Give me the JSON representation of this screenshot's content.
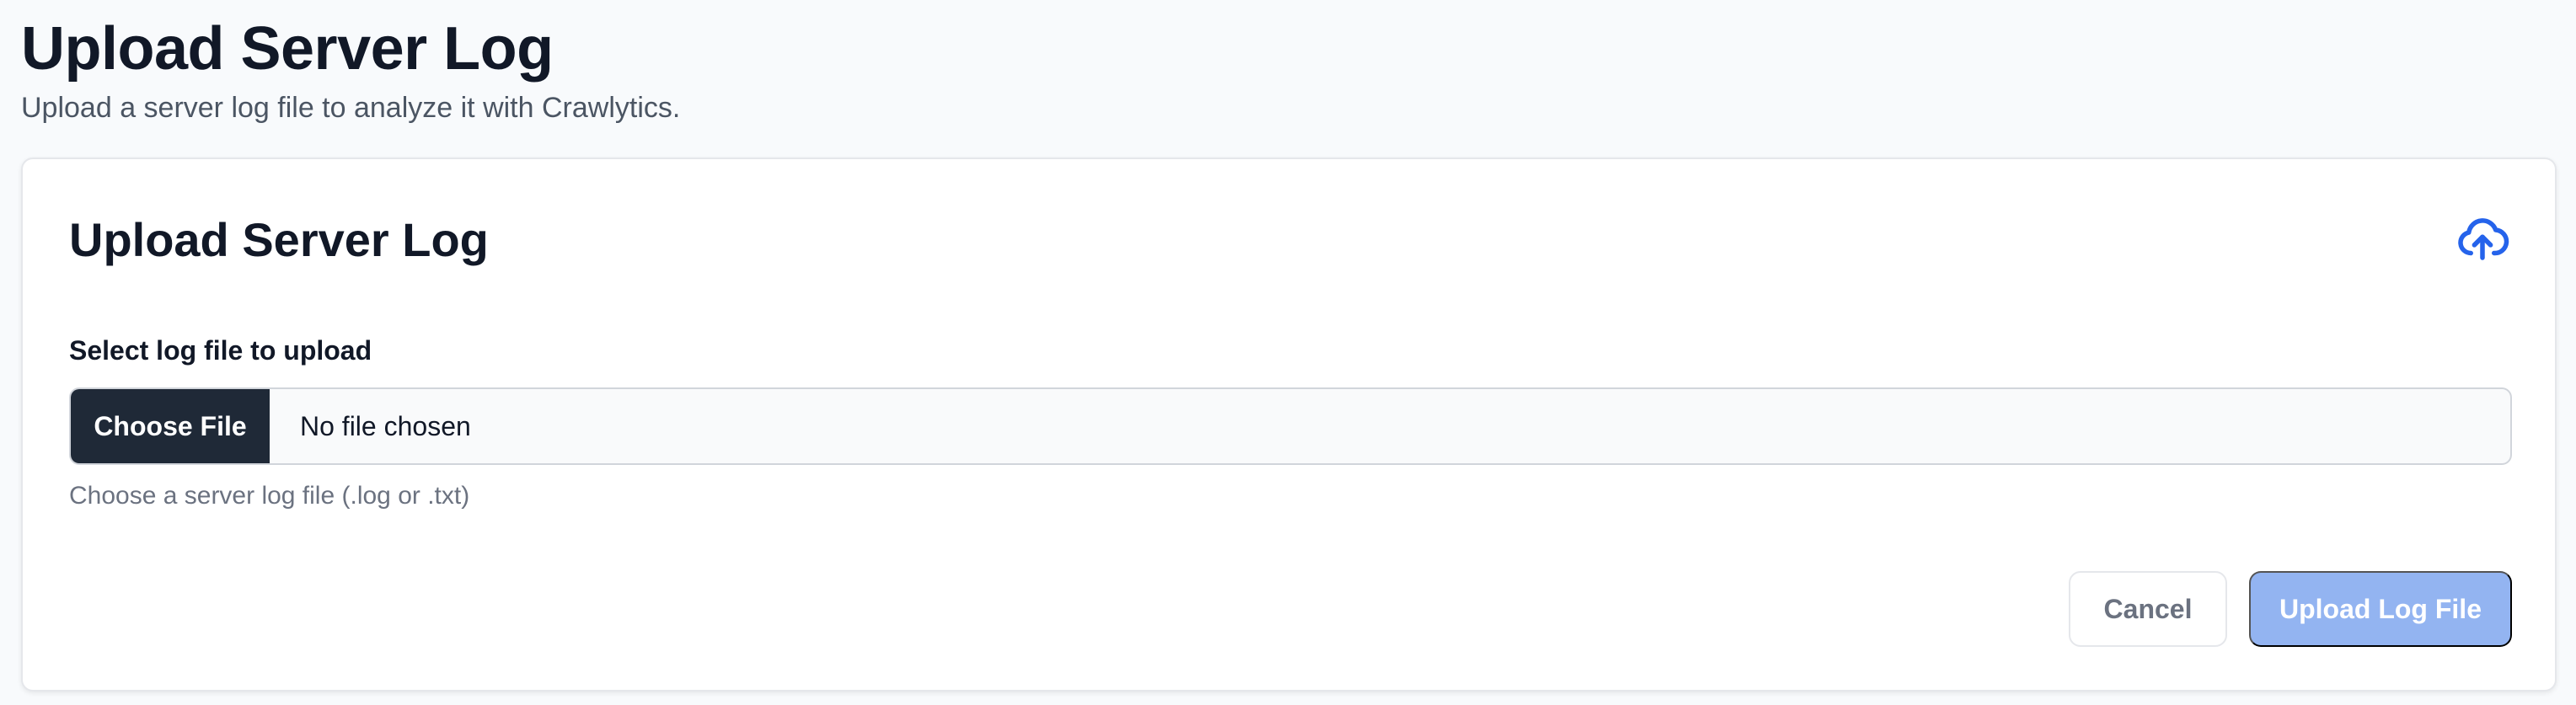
{
  "page": {
    "title": "Upload Server Log",
    "subtitle": "Upload a server log file to analyze it with Crawlytics."
  },
  "card": {
    "title": "Upload Server Log",
    "icon": "cloud-upload-icon",
    "accent_color": "#2563eb"
  },
  "form": {
    "label": "Select log file to upload",
    "choose_file_label": "Choose File",
    "file_status": "No file chosen",
    "helper_text": "Choose a server log file (.log or .txt)"
  },
  "actions": {
    "cancel_label": "Cancel",
    "upload_label": "Upload Log File",
    "upload_disabled": true
  }
}
